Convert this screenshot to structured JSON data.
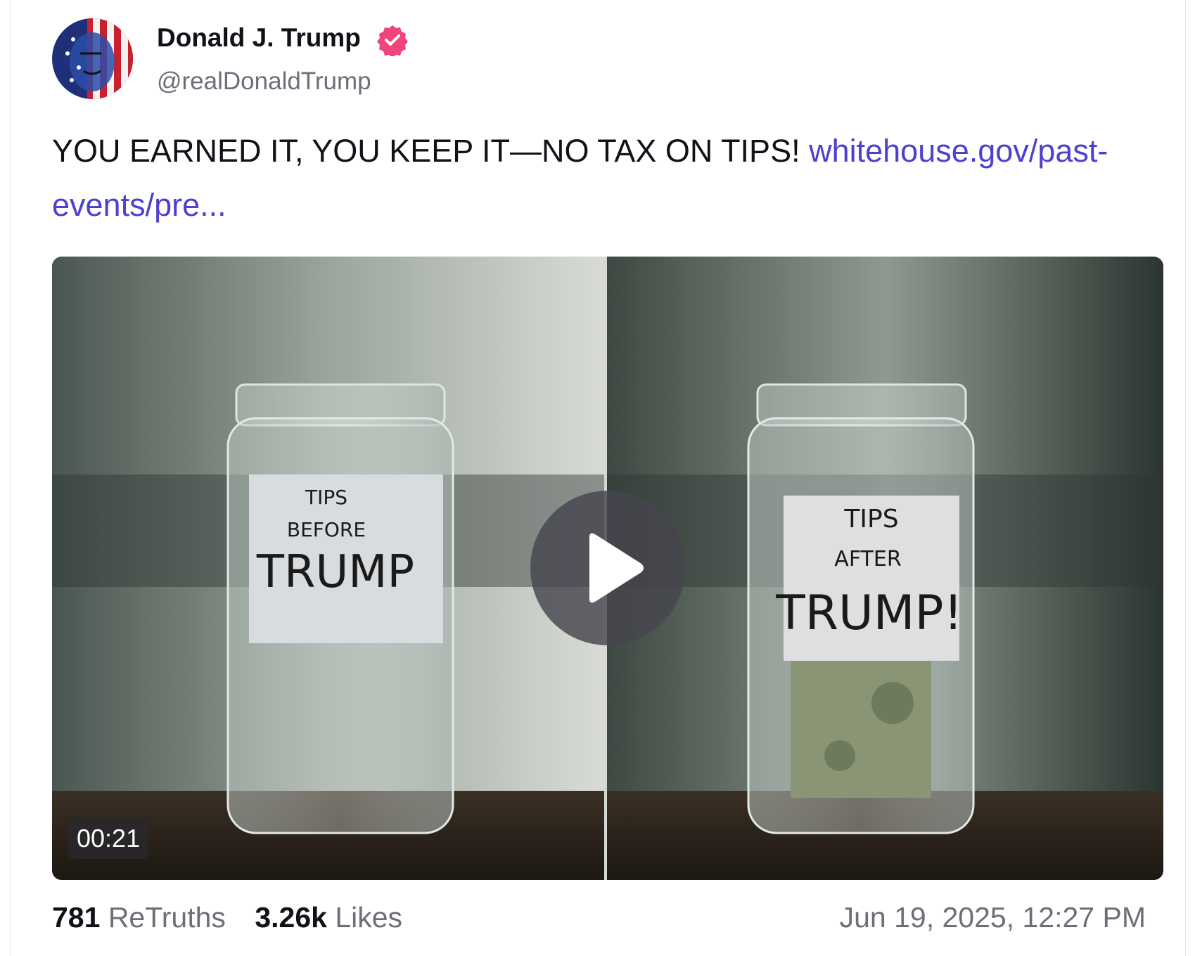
{
  "post": {
    "author_name": "Donald J. Trump",
    "handle": "@realDonaldTrump",
    "text": "YOU EARNED IT, YOU KEEP IT—NO TAX ON TIPS! ",
    "link_text": "whitehouse.gov/past-events/pre...",
    "timestamp": "Jun 19, 2025, 12:27 PM"
  },
  "video": {
    "duration": "00:21",
    "left_jar_label": [
      "TIPS",
      "BEFORE",
      "TRUMP"
    ],
    "right_jar_label": [
      "TIPS",
      "AFTER",
      "TRUMP!"
    ]
  },
  "stats": {
    "retruths_count": "781",
    "retruths_label": "ReTruths",
    "likes_count": "3.26k",
    "likes_label": "Likes"
  },
  "icons": {
    "verified": "verified-badge-icon",
    "play": "play-icon"
  },
  "colors": {
    "link": "#4c3fd1",
    "verified": "#f0457a",
    "muted": "#6e6e7a"
  }
}
